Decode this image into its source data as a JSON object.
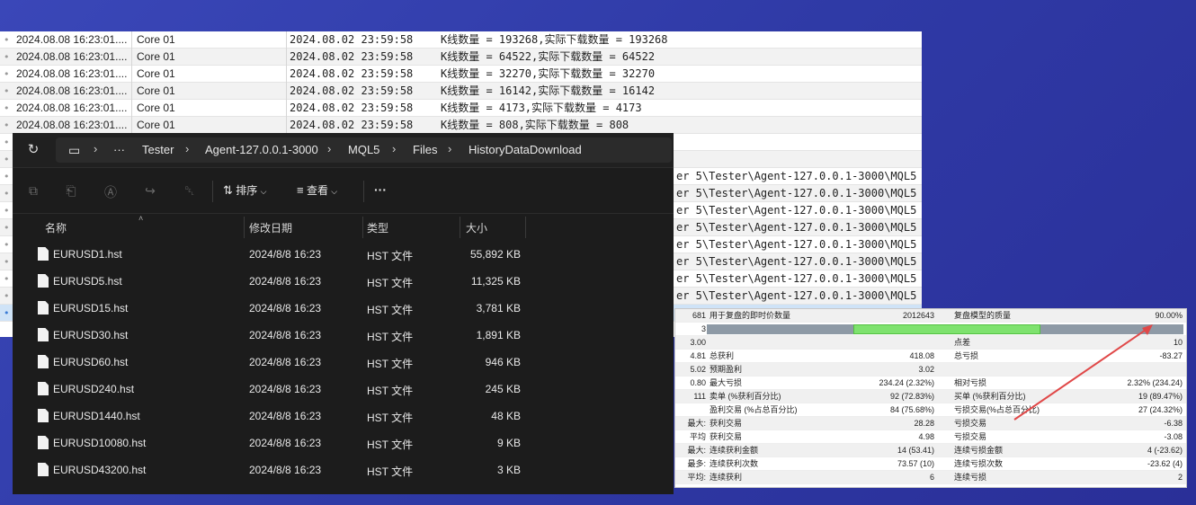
{
  "log": {
    "rows": [
      {
        "time": "2024.08.08 16:23:01....",
        "source": "Core 01",
        "ts": "2024.08.02 23:59:58",
        "msg": "K线数量 = 193268,实际下载数量 = 193268"
      },
      {
        "time": "2024.08.08 16:23:01....",
        "source": "Core 01",
        "ts": "2024.08.02 23:59:58",
        "msg": "K线数量 = 64522,实际下载数量 = 64522"
      },
      {
        "time": "2024.08.08 16:23:01....",
        "source": "Core 01",
        "ts": "2024.08.02 23:59:58",
        "msg": "K线数量 = 32270,实际下载数量 = 32270"
      },
      {
        "time": "2024.08.08 16:23:01....",
        "source": "Core 01",
        "ts": "2024.08.02 23:59:58",
        "msg": "K线数量 = 16142,实际下载数量 = 16142"
      },
      {
        "time": "2024.08.08 16:23:01....",
        "source": "Core 01",
        "ts": "2024.08.02 23:59:58",
        "msg": "K线数量 = 4173,实际下载数量 = 4173"
      },
      {
        "time": "2024.08.08 16:23:01....",
        "source": "Core 01",
        "ts": "2024.08.02 23:59:58",
        "msg": "K线数量 = 808,实际下载数量 = 808"
      }
    ],
    "path_rows": [
      "er 5\\Tester\\Agent-127.0.0.1-3000\\MQL5",
      "er 5\\Tester\\Agent-127.0.0.1-3000\\MQL5",
      "er 5\\Tester\\Agent-127.0.0.1-3000\\MQL5",
      "er 5\\Tester\\Agent-127.0.0.1-3000\\MQL5",
      "er 5\\Tester\\Agent-127.0.0.1-3000\\MQL5",
      "er 5\\Tester\\Agent-127.0.0.1-3000\\MQL5",
      "er 5\\Tester\\Agent-127.0.0.1-3000\\MQL5",
      "er 5\\Tester\\Agent-127.0.0.1-3000\\MQL5"
    ]
  },
  "explorer": {
    "breadcrumb": [
      "Tester",
      "Agent-127.0.0.1-3000",
      "MQL5",
      "Files",
      "HistoryDataDownload"
    ],
    "ellipsis": "···",
    "toolbar": {
      "sort_label": "排序",
      "view_label": "查看",
      "more_label": "···"
    },
    "columns": {
      "name": "名称",
      "date": "修改日期",
      "type": "类型",
      "size": "大小"
    },
    "files": [
      {
        "name": "EURUSD1.hst",
        "date": "2024/8/8 16:23",
        "type": "HST 文件",
        "size": "55,892 KB"
      },
      {
        "name": "EURUSD5.hst",
        "date": "2024/8/8 16:23",
        "type": "HST 文件",
        "size": "11,325 KB"
      },
      {
        "name": "EURUSD15.hst",
        "date": "2024/8/8 16:23",
        "type": "HST 文件",
        "size": "3,781 KB"
      },
      {
        "name": "EURUSD30.hst",
        "date": "2024/8/8 16:23",
        "type": "HST 文件",
        "size": "1,891 KB"
      },
      {
        "name": "EURUSD60.hst",
        "date": "2024/8/8 16:23",
        "type": "HST 文件",
        "size": "946 KB"
      },
      {
        "name": "EURUSD240.hst",
        "date": "2024/8/8 16:23",
        "type": "HST 文件",
        "size": "245 KB"
      },
      {
        "name": "EURUSD1440.hst",
        "date": "2024/8/8 16:23",
        "type": "HST 文件",
        "size": "48 KB"
      },
      {
        "name": "EURUSD10080.hst",
        "date": "2024/8/8 16:23",
        "type": "HST 文件",
        "size": "9 KB"
      },
      {
        "name": "EURUSD43200.hst",
        "date": "2024/8/8 16:23",
        "type": "HST 文件",
        "size": "3 KB"
      }
    ]
  },
  "report": {
    "quality_fraction": 0.7,
    "rows": [
      [
        "681",
        "用于复盘的即时价数量",
        "2012643",
        "复盘模型的质量",
        "90.00%"
      ],
      [
        "3",
        "",
        "",
        "",
        ""
      ],
      [
        "3.00",
        "",
        "",
        "点差",
        "10"
      ],
      [
        "4.81",
        "总获利",
        "418.08",
        "总亏损",
        "-83.27"
      ],
      [
        "5.02",
        "预期盈利",
        "3.02",
        "",
        ""
      ],
      [
        "0.80",
        "最大亏损",
        "234.24 (2.32%)",
        "相对亏损",
        "2.32% (234.24)"
      ],
      [
        "111",
        "卖单 (%获利百分比)",
        "92 (72.83%)",
        "买单 (%获利百分比)",
        "19 (89.47%)"
      ],
      [
        "",
        "盈利交易 (%占总百分比)",
        "84 (75.68%)",
        "亏损交易(%占总百分比)",
        "27 (24.32%)"
      ],
      [
        "最大:",
        "获利交易",
        "28.28",
        "亏损交易",
        "-6.38"
      ],
      [
        "平均",
        "获利交易",
        "4.98",
        "亏损交易",
        "-3.08"
      ],
      [
        "最大:",
        "连续获利金额",
        "14 (53.41)",
        "连续亏损金额",
        "4 (-23.62)"
      ],
      [
        "最多:",
        "连续获利次数",
        "73.57 (10)",
        "连续亏损次数",
        "-23.62 (4)"
      ],
      [
        "平均:",
        "连续获利",
        "6",
        "连续亏损",
        "2"
      ]
    ]
  },
  "colors": {
    "accent_arrow": "#e04848",
    "quality_bar": "#7ee26e"
  }
}
